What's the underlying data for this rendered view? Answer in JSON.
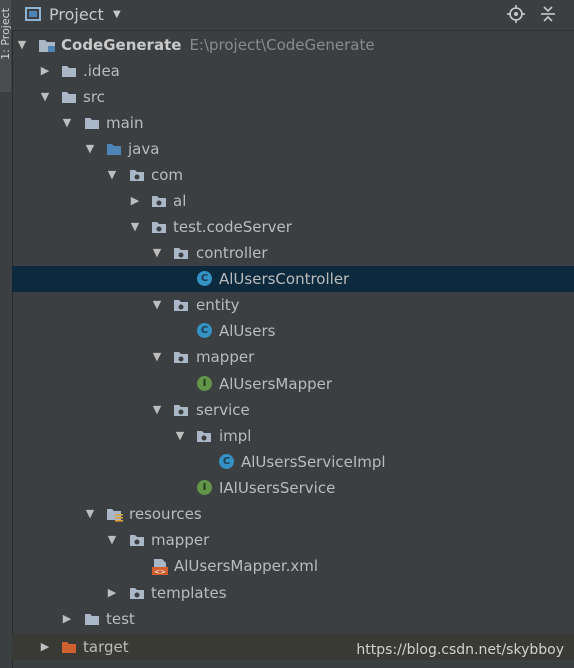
{
  "sidebar": {
    "tab_label": "1: Project"
  },
  "header": {
    "title": "Project",
    "dropdown_icon": "caret-down-icon",
    "tools": [
      "locate-icon",
      "collapse-all-icon"
    ]
  },
  "tree": {
    "root": {
      "name": "CodeGenerate",
      "path": "E:\\project\\CodeGenerate"
    },
    "idea": ".idea",
    "src": "src",
    "main": "main",
    "java": "java",
    "com": "com",
    "al": "al",
    "test_codeServer": "test.codeServer",
    "controller": "controller",
    "AlUsersController": "AlUsersController",
    "entity": "entity",
    "AlUsers": "AlUsers",
    "mapper": "mapper",
    "AlUsersMapper": "AlUsersMapper",
    "service": "service",
    "impl": "impl",
    "AlUsersServiceImpl": "AlUsersServiceImpl",
    "IAlUsersService": "IAlUsersService",
    "resources": "resources",
    "res_mapper": "mapper",
    "AlUsersMapper_xml": "AlUsersMapper.xml",
    "templates": "templates",
    "test": "test",
    "target": "target",
    "badge_class": "C",
    "badge_interface": "I"
  },
  "colors": {
    "background": "#3c3f41",
    "selection": "#0d293e",
    "folder": "#a9b7c6",
    "source_folder": "#4f84b7",
    "excluded_folder": "#d0602f",
    "class_badge": "#3592c4",
    "interface_badge": "#62954a"
  },
  "watermark": "https://blog.csdn.net/skybboy"
}
